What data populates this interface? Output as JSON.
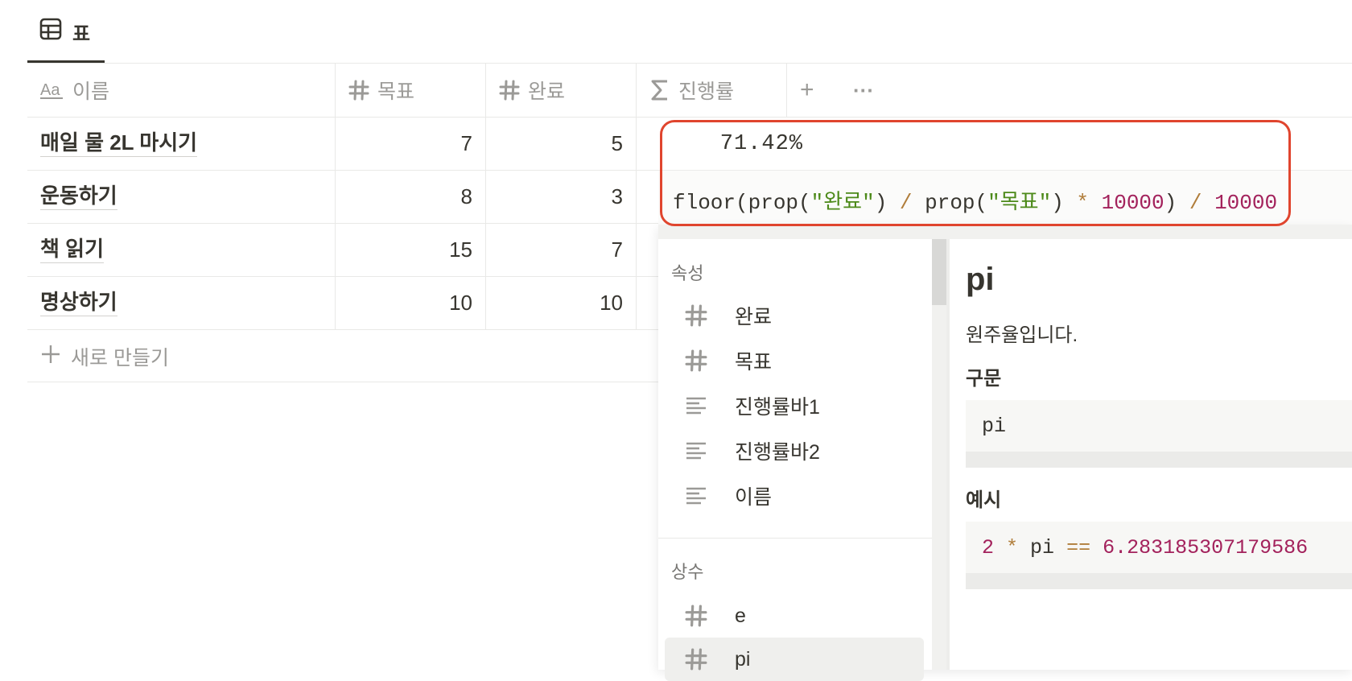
{
  "view_tab": {
    "icon": "table-icon",
    "label": "표"
  },
  "columns": [
    {
      "icon": "text-property-icon",
      "label": "이름"
    },
    {
      "icon": "number-icon",
      "label": "목표"
    },
    {
      "icon": "number-icon",
      "label": "완료"
    },
    {
      "icon": "sigma-icon",
      "label": "진행률"
    }
  ],
  "header_actions": {
    "add": "+",
    "more": "···"
  },
  "rows": [
    {
      "name": "매일 물 2L 마시기",
      "goal": "7",
      "done": "5"
    },
    {
      "name": "운동하기",
      "goal": "8",
      "done": "3"
    },
    {
      "name": "책 읽기",
      "goal": "15",
      "done": "7"
    },
    {
      "name": "명상하기",
      "goal": "10",
      "done": "10"
    }
  ],
  "new_row_label": "새로 만들기",
  "formula_result": "71.42%",
  "formula_tokens": {
    "t1": "floor(prop(",
    "t2": "\"완료\"",
    "t3": ") ",
    "t4": "/",
    "t5": " prop(",
    "t6": "\"목표\"",
    "t7": ") ",
    "t8": "*",
    "t9": " ",
    "t10": "10000",
    "t11": ") ",
    "t12": "/",
    "t13": " ",
    "t14": "10000"
  },
  "autocomplete": {
    "properties_title": "속성",
    "properties": [
      {
        "icon": "number-icon",
        "label": "완료"
      },
      {
        "icon": "number-icon",
        "label": "목표"
      },
      {
        "icon": "text-lines-icon",
        "label": "진행률바1"
      },
      {
        "icon": "text-lines-icon",
        "label": "진행률바2"
      },
      {
        "icon": "text-lines-icon",
        "label": "이름"
      }
    ],
    "constants_title": "상수",
    "constants": [
      {
        "icon": "number-icon",
        "label": "e"
      },
      {
        "icon": "number-icon",
        "label": "pi"
      }
    ],
    "selected": "pi"
  },
  "detail": {
    "title": "pi",
    "description": "원주율입니다.",
    "syntax_heading": "구문",
    "syntax": "pi",
    "example_heading": "예시",
    "example_tokens": {
      "e1": "2",
      "e2": " ",
      "e3": "*",
      "e4": " pi ",
      "e5": "==",
      "e6": " ",
      "e7": "6.283185307179586"
    }
  },
  "colors": {
    "highlight_border": "#e0452e",
    "string": "#4d8a1a",
    "operator": "#b07d3a",
    "number": "#a3225c"
  }
}
